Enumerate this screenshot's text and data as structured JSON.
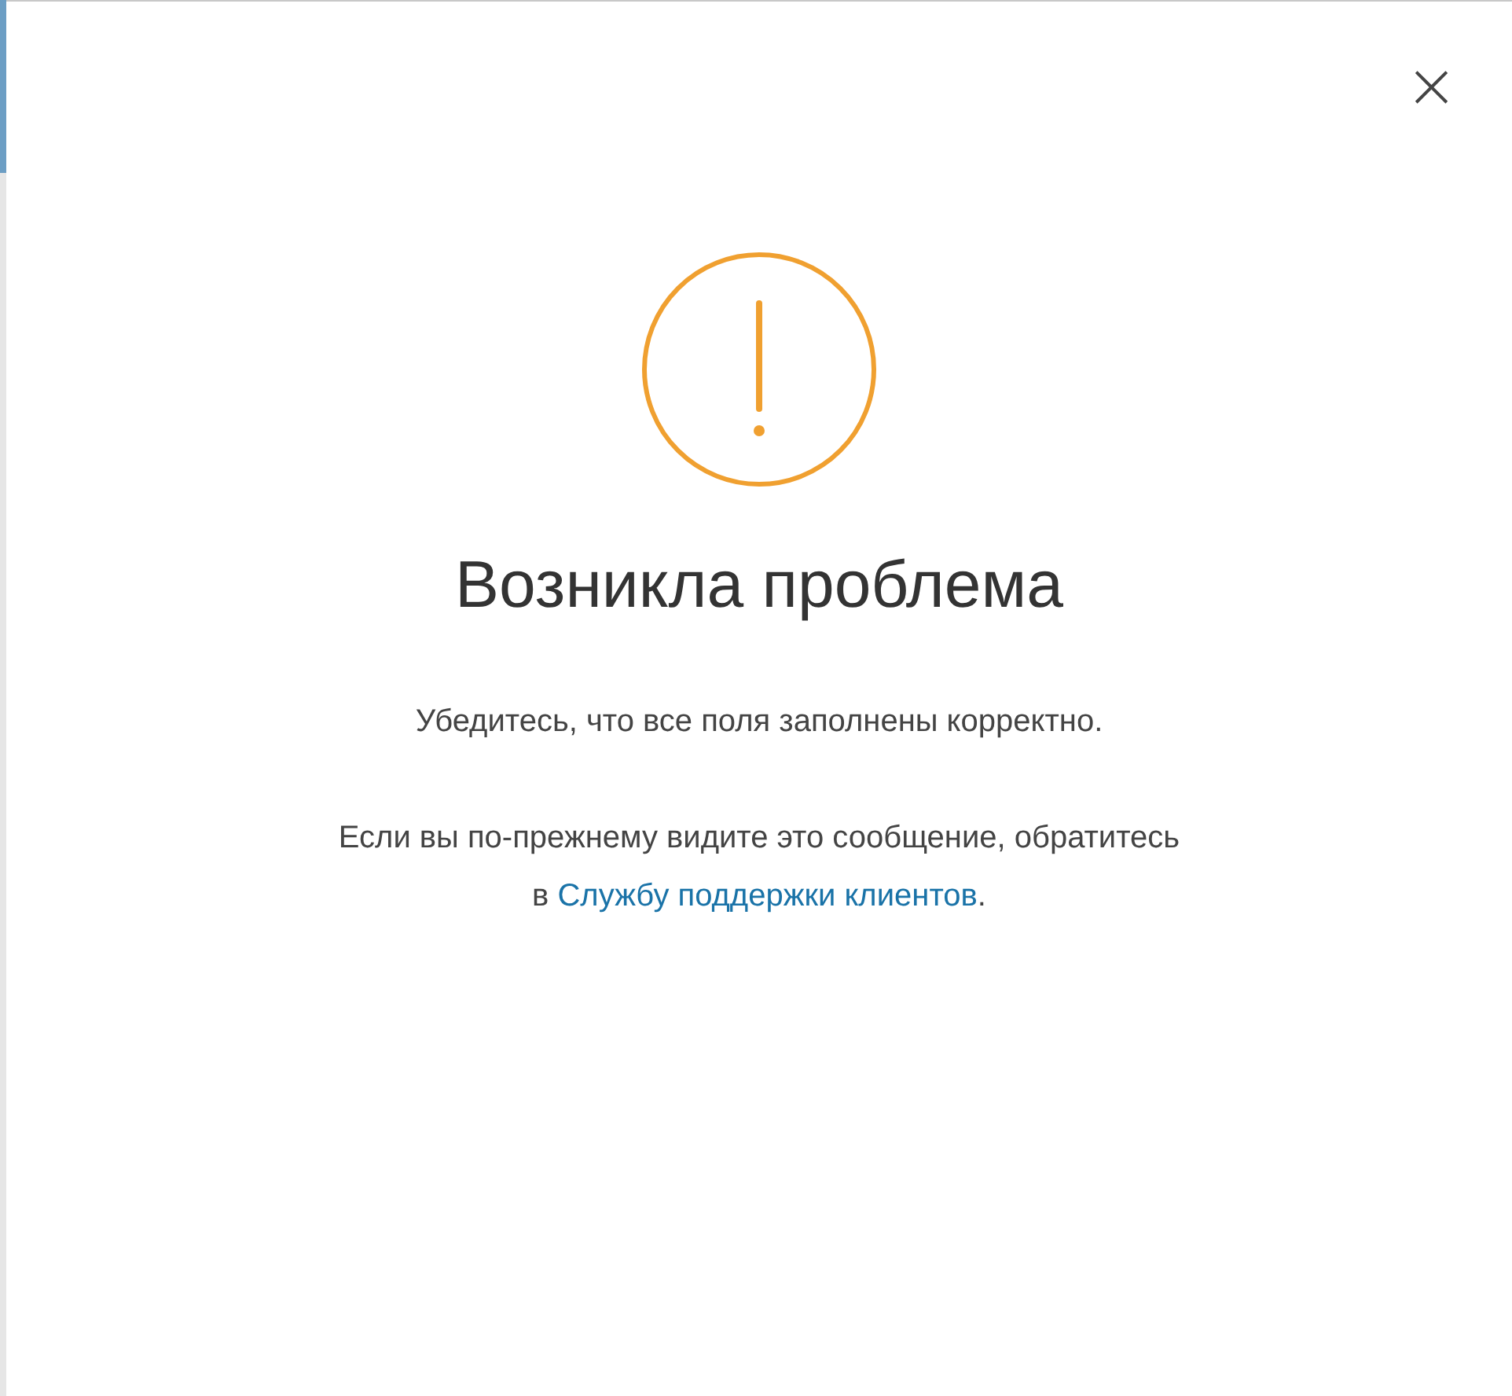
{
  "dialog": {
    "close": "×",
    "title": "Возникла проблема",
    "message": "Убедитесь, что все поля заполнены корректно.",
    "help": {
      "before": "Если вы по-прежнему видите это сообщение, обратитесь в ",
      "link": "Службу поддержки клиентов",
      "after": "."
    }
  }
}
